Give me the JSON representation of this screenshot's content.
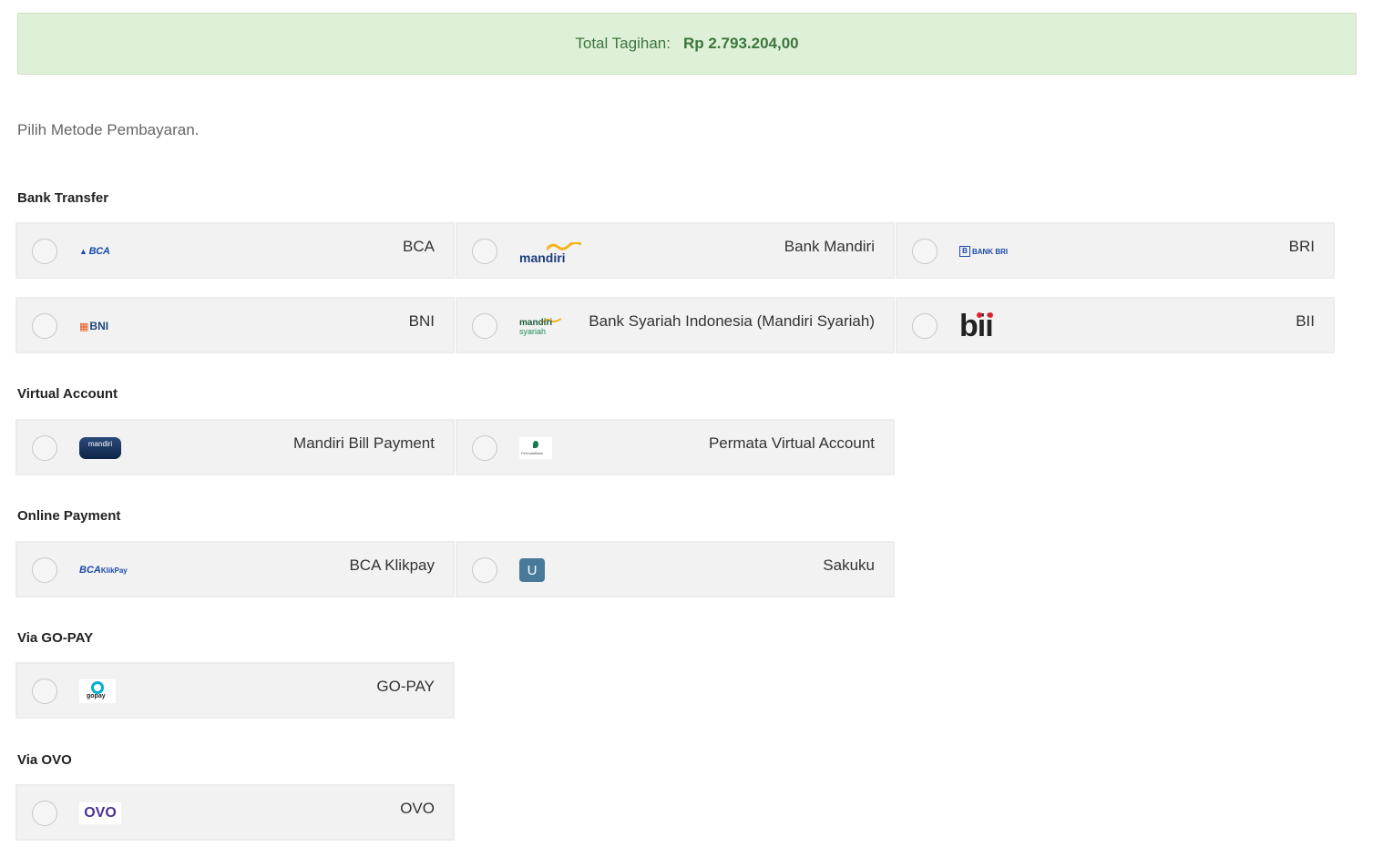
{
  "total": {
    "label": "Total Tagihan:",
    "value": "Rp 2.793.204,00"
  },
  "intro": "Pilih Metode Pembayaran.",
  "sections": {
    "bank_transfer": {
      "title": "Bank Transfer",
      "items": [
        {
          "label": "BCA",
          "logo": "BCA"
        },
        {
          "label": "Bank Mandiri",
          "logo": "mandiri"
        },
        {
          "label": "BRI",
          "logo": "BANK BRI"
        },
        {
          "label": "BNI",
          "logo": "BNI"
        },
        {
          "label": "Bank Syariah Indonesia (Mandiri Syariah)",
          "logo_a": "mandiri",
          "logo_b": "syariah"
        },
        {
          "label": "BII",
          "logo": "bii"
        }
      ]
    },
    "virtual_account": {
      "title": "Virtual Account",
      "items": [
        {
          "label": "Mandiri Bill Payment",
          "logo": "mandiri"
        },
        {
          "label": "Permata Virtual Account",
          "logo": "PermataBank"
        }
      ]
    },
    "online_payment": {
      "title": "Online Payment",
      "items": [
        {
          "label": "BCA Klikpay",
          "logo_a": "BCA",
          "logo_b": "KlikPay"
        },
        {
          "label": "Sakuku",
          "logo": "U"
        }
      ]
    },
    "gopay": {
      "title": "Via GO-PAY",
      "items": [
        {
          "label": "GO-PAY",
          "logo": "gopay"
        }
      ]
    },
    "ovo": {
      "title": "Via OVO",
      "items": [
        {
          "label": "OVO",
          "logo": "OVO"
        }
      ]
    }
  },
  "colors": {
    "success_bg": "#dff0d8",
    "success_text": "#3c763d",
    "card_bg": "#f2f2f2"
  }
}
